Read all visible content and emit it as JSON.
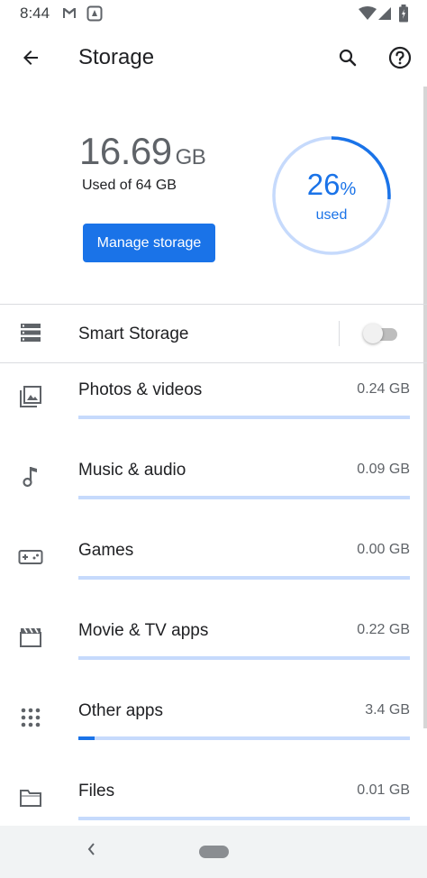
{
  "status_bar": {
    "time": "8:44",
    "left_icons": [
      "gmail-icon",
      "photo-icon"
    ],
    "right_icons": [
      "wifi-icon",
      "signal-icon",
      "battery-icon"
    ]
  },
  "app_bar": {
    "title": "Storage",
    "back_icon": "arrow-back-icon",
    "search_icon": "search-icon",
    "help_icon": "help-icon"
  },
  "summary": {
    "used_value": "16.69",
    "used_unit": "GB",
    "used_of": "Used of 64 GB",
    "manage_button": "Manage storage",
    "percent_value": "26",
    "percent_sign": "%",
    "percent_label": "used",
    "percent_fraction": 0.26
  },
  "smart_storage": {
    "label": "Smart Storage",
    "enabled": false
  },
  "categories": [
    {
      "label": "Photos & videos",
      "size": "0.24 GB",
      "icon": "photo-library-icon",
      "fill": 0
    },
    {
      "label": "Music & audio",
      "size": "0.09 GB",
      "icon": "music-note-icon",
      "fill": 0
    },
    {
      "label": "Games",
      "size": "0.00 GB",
      "icon": "gamepad-icon",
      "fill": 0
    },
    {
      "label": "Movie & TV apps",
      "size": "0.22 GB",
      "icon": "movie-icon",
      "fill": 0
    },
    {
      "label": "Other apps",
      "size": "3.4 GB",
      "icon": "apps-grid-icon",
      "fill": 0.05
    },
    {
      "label": "Files",
      "size": "0.01 GB",
      "icon": "folder-icon",
      "fill": 0
    }
  ],
  "colors": {
    "accent": "#1a73e8",
    "bar_track": "#c6dafc",
    "ring_track": "#c6dafc"
  },
  "nav_bar": {
    "back_icon": "nav-back-icon",
    "home_icon": "home-pill-icon"
  }
}
